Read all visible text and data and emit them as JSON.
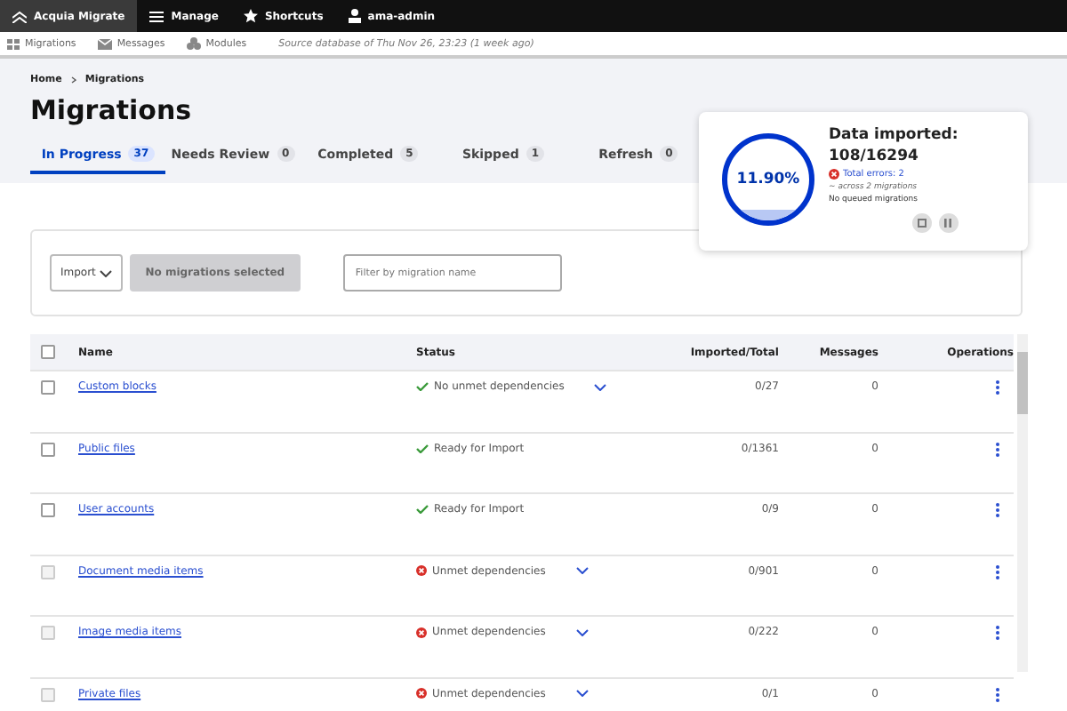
{
  "toolbar": {
    "items": [
      {
        "label": "Acquia Migrate",
        "kind": "logo",
        "selected": true
      },
      {
        "label": "Manage",
        "kind": "menu",
        "selected": false
      },
      {
        "label": "Shortcuts",
        "kind": "star",
        "selected": false
      },
      {
        "label": "ama-admin",
        "kind": "user",
        "selected": false
      }
    ]
  },
  "subbar": {
    "items": [
      {
        "label": "Migrations",
        "kind": "grid"
      },
      {
        "label": "Messages",
        "kind": "mail"
      },
      {
        "label": "Modules",
        "kind": "modules"
      }
    ],
    "note": "Source database of Thu Nov 26, 23:23 (1 week ago)"
  },
  "breadcrumb": [
    "Home",
    "Migrations"
  ],
  "title": "Migrations",
  "tabs": [
    {
      "label": "In Progress",
      "count": "37",
      "selected": true
    },
    {
      "label": "Needs Review",
      "count": "0",
      "selected": false
    },
    {
      "label": "Completed",
      "count": "5",
      "selected": false
    },
    {
      "label": "Skipped",
      "count": "1",
      "selected": false
    },
    {
      "label": "Refresh",
      "count": "0",
      "selected": false
    }
  ],
  "progress_card": {
    "percent": "11.90%",
    "heading": "Data imported:",
    "count": "108/16294",
    "errors": "Total errors: 2",
    "errors_note": "~ across 2 migrations",
    "queue": "No queued migrations"
  },
  "filters": {
    "action": "Import",
    "button": "No migrations selected",
    "placeholder": "Filter by migration name"
  },
  "table": {
    "select_all": {
      "checked": false
    },
    "columns": [
      "Name",
      "Status",
      "Imported/Total",
      "Messages",
      "Operations"
    ],
    "rows": [
      {
        "name": "Custom blocks",
        "status": "No unmet dependencies",
        "kind": "ok",
        "expandable": true,
        "disabled": false,
        "total": "0/27",
        "messages": "0"
      },
      {
        "name": "Public files",
        "status": "Ready for Import",
        "kind": "ok",
        "expandable": false,
        "disabled": false,
        "total": "0/1361",
        "messages": "0"
      },
      {
        "name": "User accounts",
        "status": "Ready for Import",
        "kind": "ok",
        "expandable": false,
        "disabled": false,
        "total": "0/9",
        "messages": "0"
      },
      {
        "name": "Document media items",
        "status": "Unmet dependencies",
        "kind": "error",
        "expandable": true,
        "disabled": true,
        "total": "0/901",
        "messages": "0"
      },
      {
        "name": "Image media items",
        "status": "Unmet dependencies",
        "kind": "error",
        "expandable": true,
        "disabled": true,
        "total": "0/222",
        "messages": "0"
      },
      {
        "name": "Private files",
        "status": "Unmet dependencies",
        "kind": "error",
        "expandable": true,
        "disabled": true,
        "total": "0/1",
        "messages": "0"
      }
    ]
  }
}
